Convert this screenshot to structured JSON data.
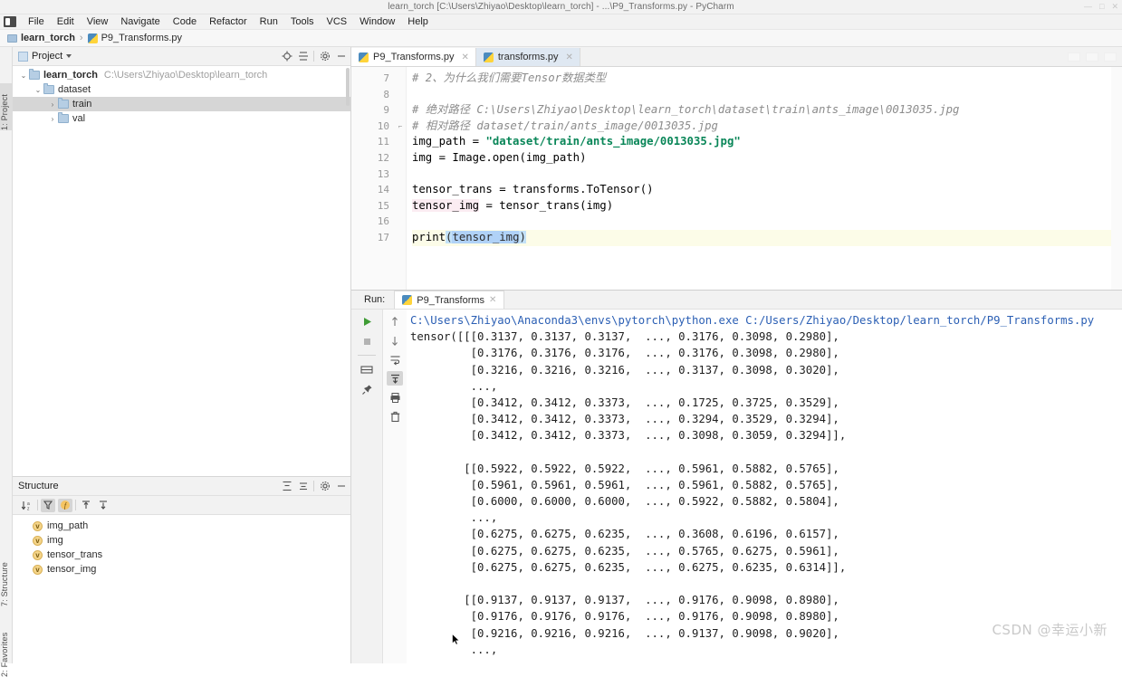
{
  "window": {
    "title": "learn_torch [C:\\Users\\Zhiyao\\Desktop\\learn_torch] - ...\\P9_Transforms.py - PyCharm",
    "minimize": "—",
    "maximize": "□",
    "close": "✕"
  },
  "menu": {
    "items": [
      "File",
      "Edit",
      "View",
      "Navigate",
      "Code",
      "Refactor",
      "Run",
      "Tools",
      "VCS",
      "Window",
      "Help"
    ]
  },
  "breadcrumb": {
    "project": "learn_torch",
    "separator": "›",
    "file": "P9_Transforms.py"
  },
  "left_strip": {
    "project_tab": "1: Project",
    "structure_tab": "7: Structure",
    "favorites_tab": "2: Favorites"
  },
  "project_panel": {
    "title": "Project",
    "caret": "▾",
    "icons": [
      "locate-target-icon",
      "collapse-all-icon",
      "settings-gear-icon",
      "hide-icon"
    ],
    "tree": [
      {
        "label": "learn_torch",
        "path": "C:\\Users\\Zhiyao\\Desktop\\learn_torch",
        "arrow": "⌄",
        "indent": 0,
        "bold": true,
        "selected": false
      },
      {
        "label": "dataset",
        "path": "",
        "arrow": "⌄",
        "indent": 1,
        "bold": false,
        "selected": false
      },
      {
        "label": "train",
        "path": "",
        "arrow": "›",
        "indent": 2,
        "bold": false,
        "selected": true
      },
      {
        "label": "val",
        "path": "",
        "arrow": "›",
        "indent": 2,
        "bold": false,
        "selected": false
      }
    ]
  },
  "structure_panel": {
    "title": "Structure",
    "icons": [
      "sort-alphabetically-icon",
      "collapse-icon",
      "expand-icon",
      "settings-gear-icon",
      "hide-icon"
    ],
    "toolbar": [
      {
        "name": "sort-alphabetically-icon",
        "glyph": "⇩ₐ",
        "active": false
      },
      {
        "name": "filter-fields-icon",
        "glyph": "⛏",
        "active": true
      },
      {
        "name": "show-fields-icon",
        "glyph": "f",
        "active": true
      },
      {
        "name": "expand-all-icon",
        "glyph": "⤒",
        "active": false
      },
      {
        "name": "collapse-all-icon",
        "glyph": "⤓",
        "active": false
      }
    ],
    "items": [
      {
        "badge": "v",
        "label": "img_path"
      },
      {
        "badge": "v",
        "label": "img"
      },
      {
        "badge": "v",
        "label": "tensor_trans"
      },
      {
        "badge": "v",
        "label": "tensor_img"
      }
    ]
  },
  "editor": {
    "tabs": [
      {
        "label": "P9_Transforms.py",
        "active": true,
        "close": "✕"
      },
      {
        "label": "transforms.py",
        "active": false,
        "close": "✕"
      }
    ],
    "first_line_number": 7,
    "lines": [
      {
        "n": 7,
        "fold": "",
        "highlight": false,
        "segments": [
          {
            "t": "# 2、为什么我们需要Tensor数据类型",
            "c": "cm"
          }
        ]
      },
      {
        "n": 8,
        "fold": "",
        "highlight": false,
        "segments": []
      },
      {
        "n": 9,
        "fold": "",
        "highlight": false,
        "segments": [
          {
            "t": "# 绝对路径 C:\\Users\\Zhiyao\\Desktop\\learn_torch\\dataset\\train\\ants_image\\0013035.jpg",
            "c": "cm"
          }
        ]
      },
      {
        "n": 10,
        "fold": "⌐",
        "highlight": false,
        "segments": [
          {
            "t": "# 相对路径 dataset/train/ants_image/0013035.jpg",
            "c": "cm"
          }
        ]
      },
      {
        "n": 11,
        "fold": "",
        "highlight": false,
        "segments": [
          {
            "t": "img_path = ",
            "c": "idn"
          },
          {
            "t": "\"dataset/train/ants_image/0013035.jpg\"",
            "c": "str"
          }
        ]
      },
      {
        "n": 12,
        "fold": "",
        "highlight": false,
        "segments": [
          {
            "t": "img = Image.open(img_path)",
            "c": "idn"
          }
        ]
      },
      {
        "n": 13,
        "fold": "",
        "highlight": false,
        "segments": []
      },
      {
        "n": 14,
        "fold": "",
        "highlight": false,
        "segments": [
          {
            "t": "tensor_trans = transforms.ToTensor()",
            "c": "idn"
          }
        ]
      },
      {
        "n": 15,
        "fold": "",
        "highlight": false,
        "segments": [
          {
            "t": "tensor_img",
            "c": "idn-pink"
          },
          {
            "t": " = tensor_trans(img)",
            "c": "idn"
          }
        ]
      },
      {
        "n": 16,
        "fold": "",
        "highlight": false,
        "segments": []
      },
      {
        "n": 17,
        "fold": "",
        "highlight": true,
        "segments": [
          {
            "t": "print",
            "c": "fn"
          },
          {
            "t": "(",
            "c": "paren"
          },
          {
            "t": "tensor_img",
            "c": "sel"
          },
          {
            "t": ")",
            "c": "paren"
          }
        ]
      }
    ]
  },
  "run_panel": {
    "label": "Run:",
    "tab_label": "P9_Transforms",
    "tab_close": "✕",
    "tools_left": [
      {
        "name": "run-button",
        "glyph": "▶",
        "active": false
      },
      {
        "name": "stop-button",
        "glyph": "■",
        "active": false
      },
      {
        "name": "console-toggle-icon",
        "glyph": "⌸",
        "active": false
      },
      {
        "name": "pin-tab-icon",
        "glyph": "✐",
        "active": false
      }
    ],
    "tools_right": [
      {
        "name": "up-the-stack-trace-icon",
        "glyph": "↑",
        "active": false
      },
      {
        "name": "down-the-stack-trace-icon",
        "glyph": "↓",
        "active": false
      },
      {
        "name": "soft-wrap-icon",
        "glyph": "↵",
        "active": false
      },
      {
        "name": "scroll-to-end-icon",
        "glyph": "⤓",
        "active": true
      },
      {
        "name": "print-icon",
        "glyph": "⎙",
        "active": false
      },
      {
        "name": "clear-all-icon",
        "glyph": "Ὕ1",
        "active": false
      }
    ],
    "command": "C:\\Users\\Zhiyao\\Anaconda3\\envs\\pytorch\\python.exe C:/Users/Zhiyao/Desktop/learn_torch/P9_Transforms.py",
    "output": [
      "tensor([[[0.3137, 0.3137, 0.3137,  ..., 0.3176, 0.3098, 0.2980],",
      "         [0.3176, 0.3176, 0.3176,  ..., 0.3176, 0.3098, 0.2980],",
      "         [0.3216, 0.3216, 0.3216,  ..., 0.3137, 0.3098, 0.3020],",
      "         ...,",
      "         [0.3412, 0.3412, 0.3373,  ..., 0.1725, 0.3725, 0.3529],",
      "         [0.3412, 0.3412, 0.3373,  ..., 0.3294, 0.3529, 0.3294],",
      "         [0.3412, 0.3412, 0.3373,  ..., 0.3098, 0.3059, 0.3294]],",
      "",
      "        [[0.5922, 0.5922, 0.5922,  ..., 0.5961, 0.5882, 0.5765],",
      "         [0.5961, 0.5961, 0.5961,  ..., 0.5961, 0.5882, 0.5765],",
      "         [0.6000, 0.6000, 0.6000,  ..., 0.5922, 0.5882, 0.5804],",
      "         ...,",
      "         [0.6275, 0.6275, 0.6235,  ..., 0.3608, 0.6196, 0.6157],",
      "         [0.6275, 0.6275, 0.6235,  ..., 0.5765, 0.6275, 0.5961],",
      "         [0.6275, 0.6275, 0.6235,  ..., 0.6275, 0.6235, 0.6314]],",
      "",
      "        [[0.9137, 0.9137, 0.9137,  ..., 0.9176, 0.9098, 0.8980],",
      "         [0.9176, 0.9176, 0.9176,  ..., 0.9176, 0.9098, 0.8980],",
      "         [0.9216, 0.9216, 0.9216,  ..., 0.9137, 0.9098, 0.9020],",
      "         ...,"
    ]
  },
  "watermark": "CSDN @幸运小新",
  "colors": {
    "accent_blue": "#2b5fb4",
    "string_green": "#098658",
    "comment_gray": "#8c8c8c",
    "selection_blue": "#b0d2f7",
    "panel_bg": "#f2f2f2"
  }
}
